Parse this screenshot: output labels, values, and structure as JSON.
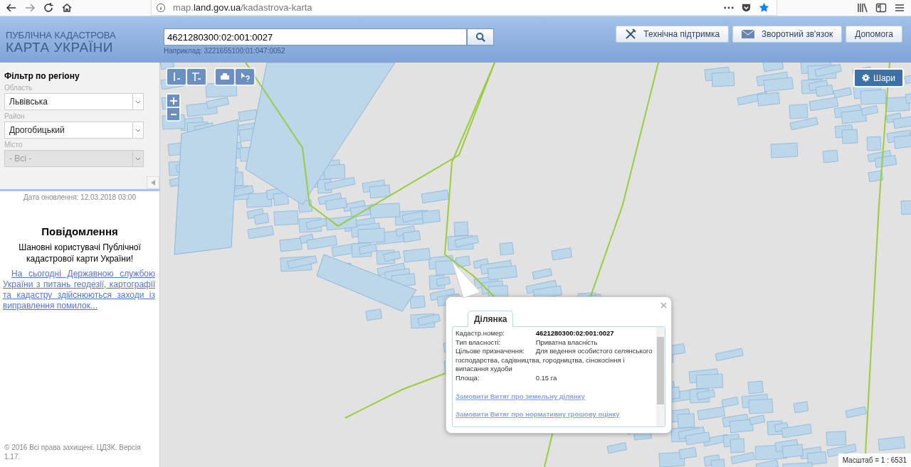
{
  "browser": {
    "url": "map.**land.gov.ua**/kadastrova-karta"
  },
  "header": {
    "logo_line1": "ПУБЛІЧНА КАДАСТРОВА",
    "logo_line2": "КАРТА УКРАЇНИ",
    "search": {
      "value": "4621280300:02:001:0027",
      "hint": "Наприклад: 3221655100:01:047:0052"
    },
    "buttons": [
      {
        "label": "Технічна підтримка",
        "kind": "tools"
      },
      {
        "label": "Зворотний зв'язок",
        "kind": "mail"
      },
      {
        "label": "Допомога",
        "kind": "plain"
      }
    ]
  },
  "sidebar": {
    "title": "Фільтр по регіону",
    "fields": [
      {
        "label": "Область",
        "value": "Львівська",
        "disabled": false
      },
      {
        "label": "Район",
        "value": "Дрогобицький",
        "disabled": false
      },
      {
        "label": "Місто",
        "value": "- Всі -",
        "disabled": true
      }
    ],
    "update_date": "Дата оновлення: 12.03.2018 03:00",
    "notice": {
      "title": "Повідомлення",
      "greeting": "Шановні користувачі Публічної кадастрової карти України!",
      "link": "На сьогодні Державною службою України з питань геодезії, картографії та кадастру здійснюються заходи із виправлення помилок..."
    },
    "footer": "© 2016 Всі права захищені. ЦДЗК. Версія 1.17."
  },
  "map": {
    "layers_button": "Шари",
    "scale": "Масштаб = 1 : 6531",
    "popup": {
      "tab": "Ділянка",
      "rows": [
        {
          "label": "Кадастр.номер:",
          "value": "4621280300:02:001:0027",
          "bold": true
        },
        {
          "label": "Тип власності:",
          "value": "Приватна власність",
          "bold": false
        },
        {
          "label": "Цільове призначення:",
          "value": "Для ведення особистого селянського господарства, садівництва, городництва, сінокосіння і випасання худоби",
          "bold": false
        },
        {
          "label": "Площа:",
          "value": "0.15 га",
          "bold": false
        }
      ],
      "links": [
        "Замовити Витяг про земельну ділянку",
        "Замовити Витяг про нормативну грошову оцінку"
      ]
    }
  }
}
